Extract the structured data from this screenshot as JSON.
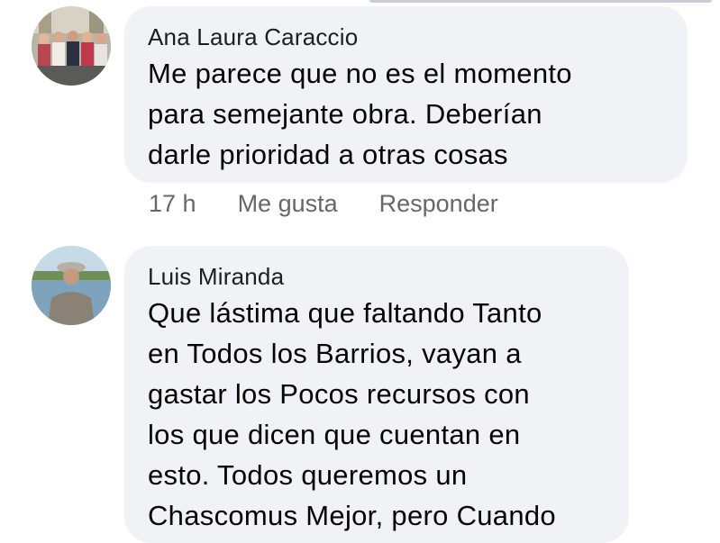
{
  "comments": [
    {
      "author": "Ana Laura Caraccio",
      "text": "Me parece que no es el momento\npara semejante obra. Deberían\ndarle prioridad a otras cosas",
      "time": "17 h",
      "like_label": "Me gusta",
      "reply_label": "Responder"
    },
    {
      "author": "Luis Miranda",
      "text": "Que lástima que faltando Tanto\nen Todos los Barrios, vayan a\ngastar los Pocos recursos con\nlos que dicen que cuentan en\nesto. Todos queremos un\nChascomus Mejor, pero Cuando"
    }
  ],
  "colors": {
    "bubble": "#f0f2f5",
    "meta": "#65676b",
    "text": "#050505"
  }
}
